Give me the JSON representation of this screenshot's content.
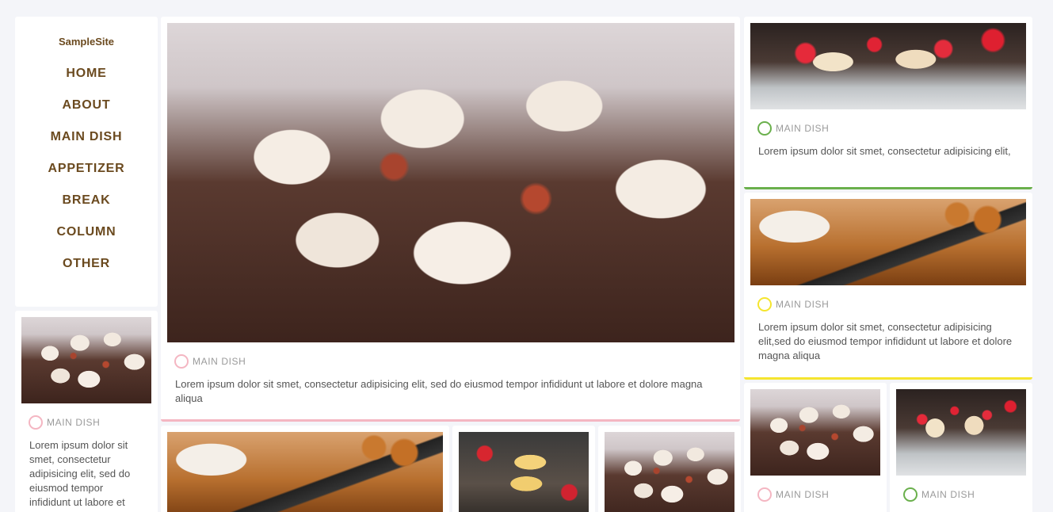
{
  "site": {
    "logo": "SampleSite"
  },
  "nav": {
    "items": [
      {
        "label": "HOME"
      },
      {
        "label": "ABOUT"
      },
      {
        "label": "MAIN DISH"
      },
      {
        "label": "APPETIZER"
      },
      {
        "label": "BREAK"
      },
      {
        "label": "COLUMN"
      },
      {
        "label": "OTHER"
      }
    ]
  },
  "colors": {
    "pink": "#f4b6c2",
    "green": "#6ab04c",
    "yellow": "#f5e52e",
    "brown": "#6b4a1f"
  },
  "posts": {
    "sidebar_post": {
      "category": "MAIN DISH",
      "accent": "pink",
      "image": "cupcakes",
      "text": "Lorem ipsum dolor sit smet, consectetur adipisicing elit, sed do eiusmod tempor infididunt ut labore et"
    },
    "featured": {
      "category": "MAIN DISH",
      "accent": "pink",
      "image": "cupcakes",
      "text": "Lorem ipsum dolor sit smet, consectetur adipisicing elit, sed do eiusmod tempor infididunt ut labore et dolore magna aliqua"
    },
    "right_1": {
      "category": "MAIN DISH",
      "accent": "green",
      "image": "strawberry-tarts",
      "text": "Lorem ipsum dolor sit smet, consectetur adipisicing elit,"
    },
    "right_2": {
      "category": "MAIN DISH",
      "accent": "yellow",
      "image": "tea-and-ereader",
      "text": "Lorem ipsum dolor sit smet, consectetur adipisicing elit,sed do eiusmod tempor infididunt ut labore et dolore magna aliqua"
    },
    "right_3": {
      "category": "MAIN DISH",
      "accent": "pink",
      "image": "cupcakes"
    },
    "right_4": {
      "category": "MAIN DISH",
      "accent": "green",
      "image": "strawberry-tarts"
    },
    "bottom_1": {
      "image": "tea-and-ereader"
    },
    "bottom_2": {
      "image": "strawberry-eclairs"
    },
    "bottom_3": {
      "image": "cupcakes"
    }
  }
}
